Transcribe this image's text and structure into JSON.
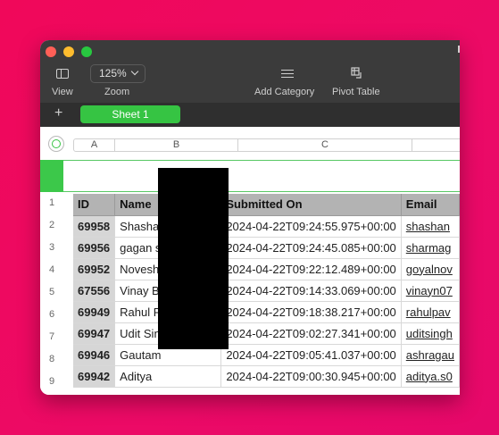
{
  "toolbar": {
    "view_label": "View",
    "zoom_value": "125%",
    "zoom_label": "Zoom",
    "add_category_label": "Add Category",
    "pivot_table_label": "Pivot Table"
  },
  "tabs": {
    "add_symbol": "+",
    "sheets": [
      {
        "label": "Sheet 1",
        "active": true
      }
    ]
  },
  "columns": [
    "A",
    "B",
    "C"
  ],
  "row_numbers": [
    "1",
    "2",
    "3",
    "4",
    "5",
    "6",
    "7",
    "8",
    "9"
  ],
  "table": {
    "headers": [
      "ID",
      "Name",
      "Submitted On",
      "Email"
    ],
    "rows": [
      [
        "69958",
        "Shasha",
        "2024-04-22T09:24:55.975+00:00",
        "shashan"
      ],
      [
        "69956",
        "gagan s",
        "2024-04-22T09:24:45.085+00:00",
        "sharmag"
      ],
      [
        "69952",
        "Novesh",
        "2024-04-22T09:22:12.489+00:00",
        "goyalnov"
      ],
      [
        "67556",
        "Vinay B",
        "2024-04-22T09:14:33.069+00:00",
        "vinayn07"
      ],
      [
        "69949",
        "Rahul P",
        "2024-04-22T09:18:38.217+00:00",
        "rahulpav"
      ],
      [
        "69947",
        "Udit Sin",
        "2024-04-22T09:02:27.341+00:00",
        "uditsingh"
      ],
      [
        "69946",
        "Gautam",
        "2024-04-22T09:05:41.037+00:00",
        "ashragau"
      ],
      [
        "69942",
        "Aditya",
        "2024-04-22T09:00:30.945+00:00",
        "aditya.s0"
      ]
    ]
  },
  "colors": {
    "accent": "#36c443",
    "background": "#ef0860",
    "titlebar": "#3b3b3b",
    "tabbar": "#2f2f2f",
    "header_fill": "#b3b3b3"
  }
}
